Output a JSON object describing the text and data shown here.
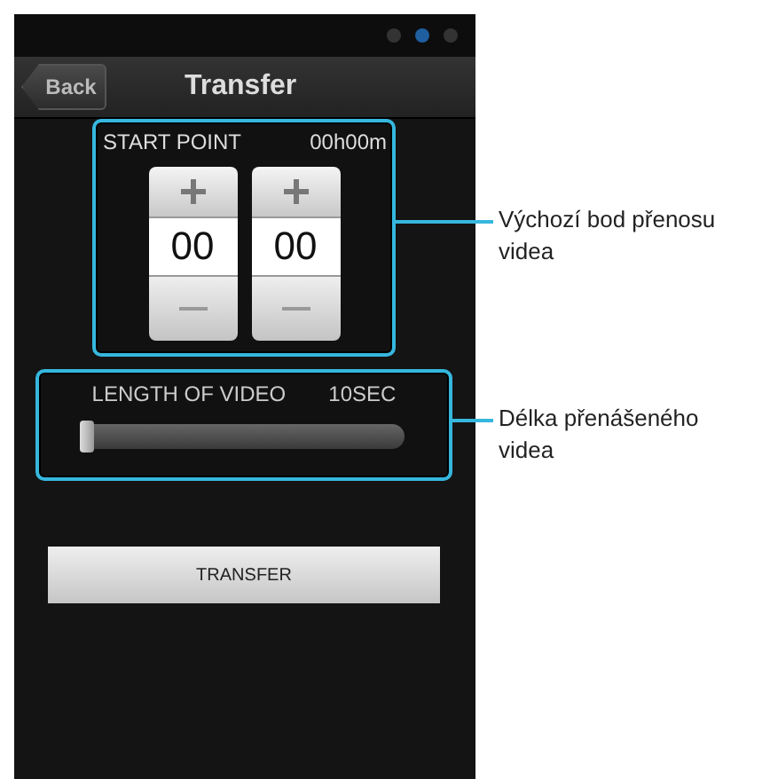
{
  "header": {
    "back_button": "Back",
    "title": "Transfer"
  },
  "start_point": {
    "label": "START POINT",
    "reading": "00h00m",
    "spinners": [
      {
        "value": "00"
      },
      {
        "value": "00"
      }
    ]
  },
  "length_of_video": {
    "label": "LENGTH OF VIDEO",
    "reading": "10SEC",
    "level": 0
  },
  "transfer_button": "TRANSFER",
  "callouts": [
    {
      "text": "Výchozí bod přenosu videa"
    },
    {
      "text": "Délka přenášeného videa"
    }
  ]
}
